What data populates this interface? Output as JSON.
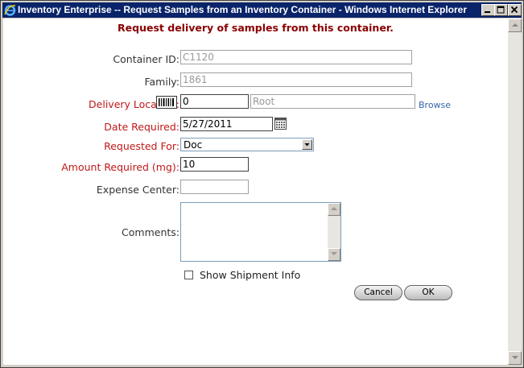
{
  "window": {
    "title": "Inventory Enterprise -- Request Samples from an Inventory Container - Windows Internet Explorer"
  },
  "form": {
    "heading": "Request delivery of samples from this container.",
    "container_id": {
      "label": "Container ID:",
      "value": "C1120"
    },
    "family": {
      "label": "Family:",
      "value": "1861"
    },
    "delivery_location": {
      "label": "Delivery Location:",
      "code": "0",
      "name": "Root",
      "browse_label": "Browse"
    },
    "date_required": {
      "label": "Date Required:",
      "value": "5/27/2011"
    },
    "requested_for": {
      "label": "Requested For:",
      "value": "Doc"
    },
    "amount_required": {
      "label": "Amount Required (mg):",
      "value": "10"
    },
    "expense_center": {
      "label": "Expense Center:",
      "value": ""
    },
    "comments": {
      "label": "Comments:",
      "value": ""
    },
    "show_shipment": {
      "label": "Show Shipment Info",
      "checked": false
    },
    "buttons": {
      "cancel": "Cancel",
      "ok": "OK"
    }
  },
  "colors": {
    "title_bar": "#0a246a",
    "heading": "#8b0000",
    "required_label": "#c01818",
    "link": "#3366aa"
  }
}
